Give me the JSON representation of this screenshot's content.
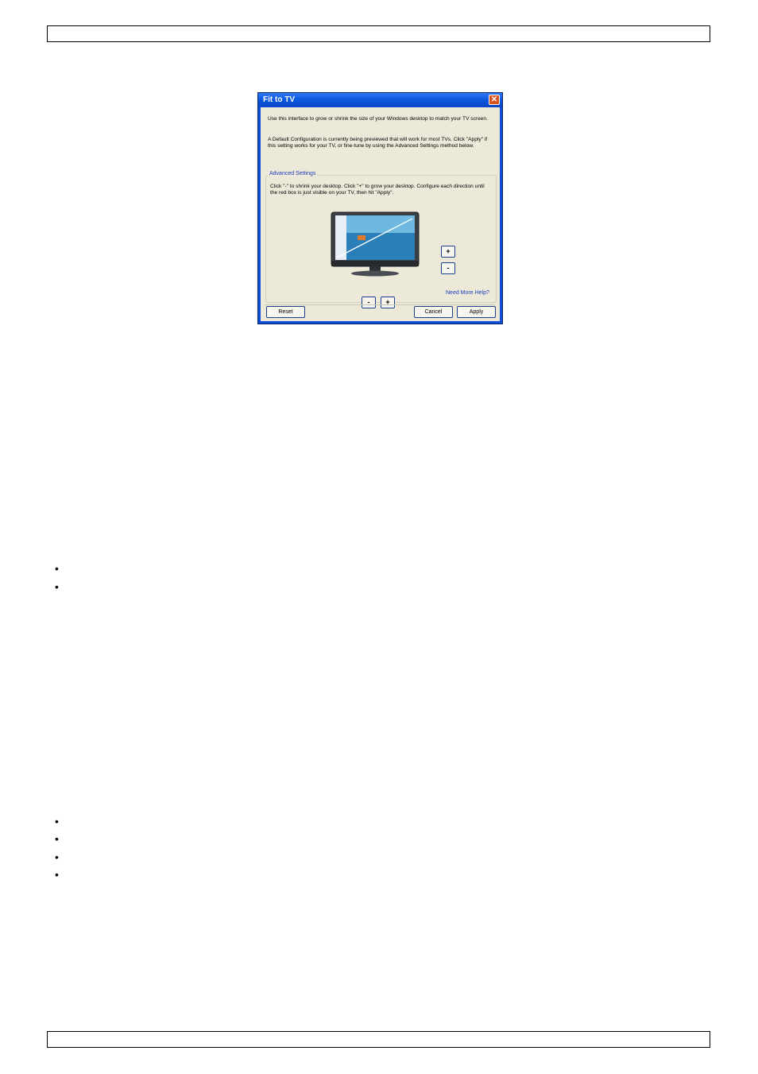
{
  "dialog": {
    "title": "Fit to TV",
    "close_symbol": "✕",
    "intro": "Use this interface to grow or shrink the size of your Windows desktop to match your TV screen.",
    "intro2": "A Default Configuration is currently being previewed that will work for most TVs. Click \"Apply\" if this setting works for your TV, or fine-tune by using the Advanced Settings method below.",
    "advanced_label": "Advanced Settings",
    "instructions": "Click \"-\" to shrink your desktop. Click \"+\" to grow your desktop. Configure each direction until the red box is just visible on your TV, then hit \"Apply\".",
    "vertical_plus": "+",
    "vertical_minus": "-",
    "horizontal_minus": "-",
    "horizontal_plus": "+",
    "help_link": "Need More Help?",
    "reset_label": "Reset",
    "cancel_label": "Cancel",
    "apply_label": "Apply"
  },
  "bullets": {
    "symbol": "•"
  }
}
